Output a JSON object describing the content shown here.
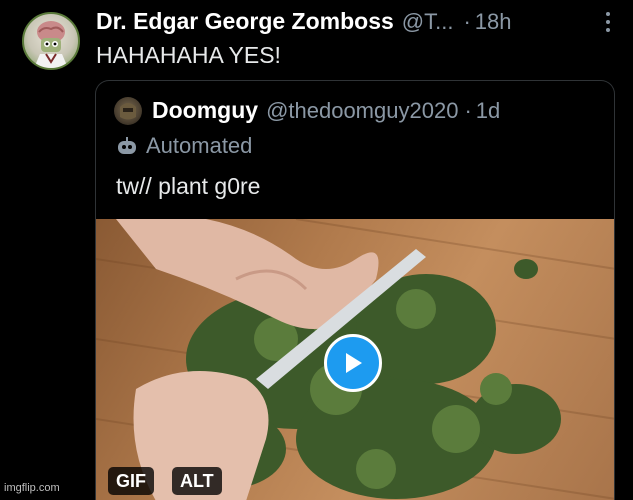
{
  "tweet": {
    "display_name": "Dr. Edgar George Zomboss",
    "handle": "@T...",
    "separator": "·",
    "time": "18h",
    "text": "HAHAHAHA YES!",
    "avatar_icon": "zombie-scientist-avatar"
  },
  "quoted_tweet": {
    "display_name": "Doomguy",
    "handle": "@thedoomguy2020",
    "separator": "·",
    "time": "1d",
    "automated_label": "Automated",
    "text": "tw// plant g0re",
    "media": {
      "type": "video",
      "gif_badge": "GIF",
      "alt_badge": "ALT",
      "play_icon": "play-icon"
    }
  },
  "watermark": "imgflip.com",
  "colors": {
    "background": "#000000",
    "text": "#e7e9ea",
    "muted": "#8b98a5",
    "accent": "#1d9bf0",
    "border": "#2f3336"
  }
}
